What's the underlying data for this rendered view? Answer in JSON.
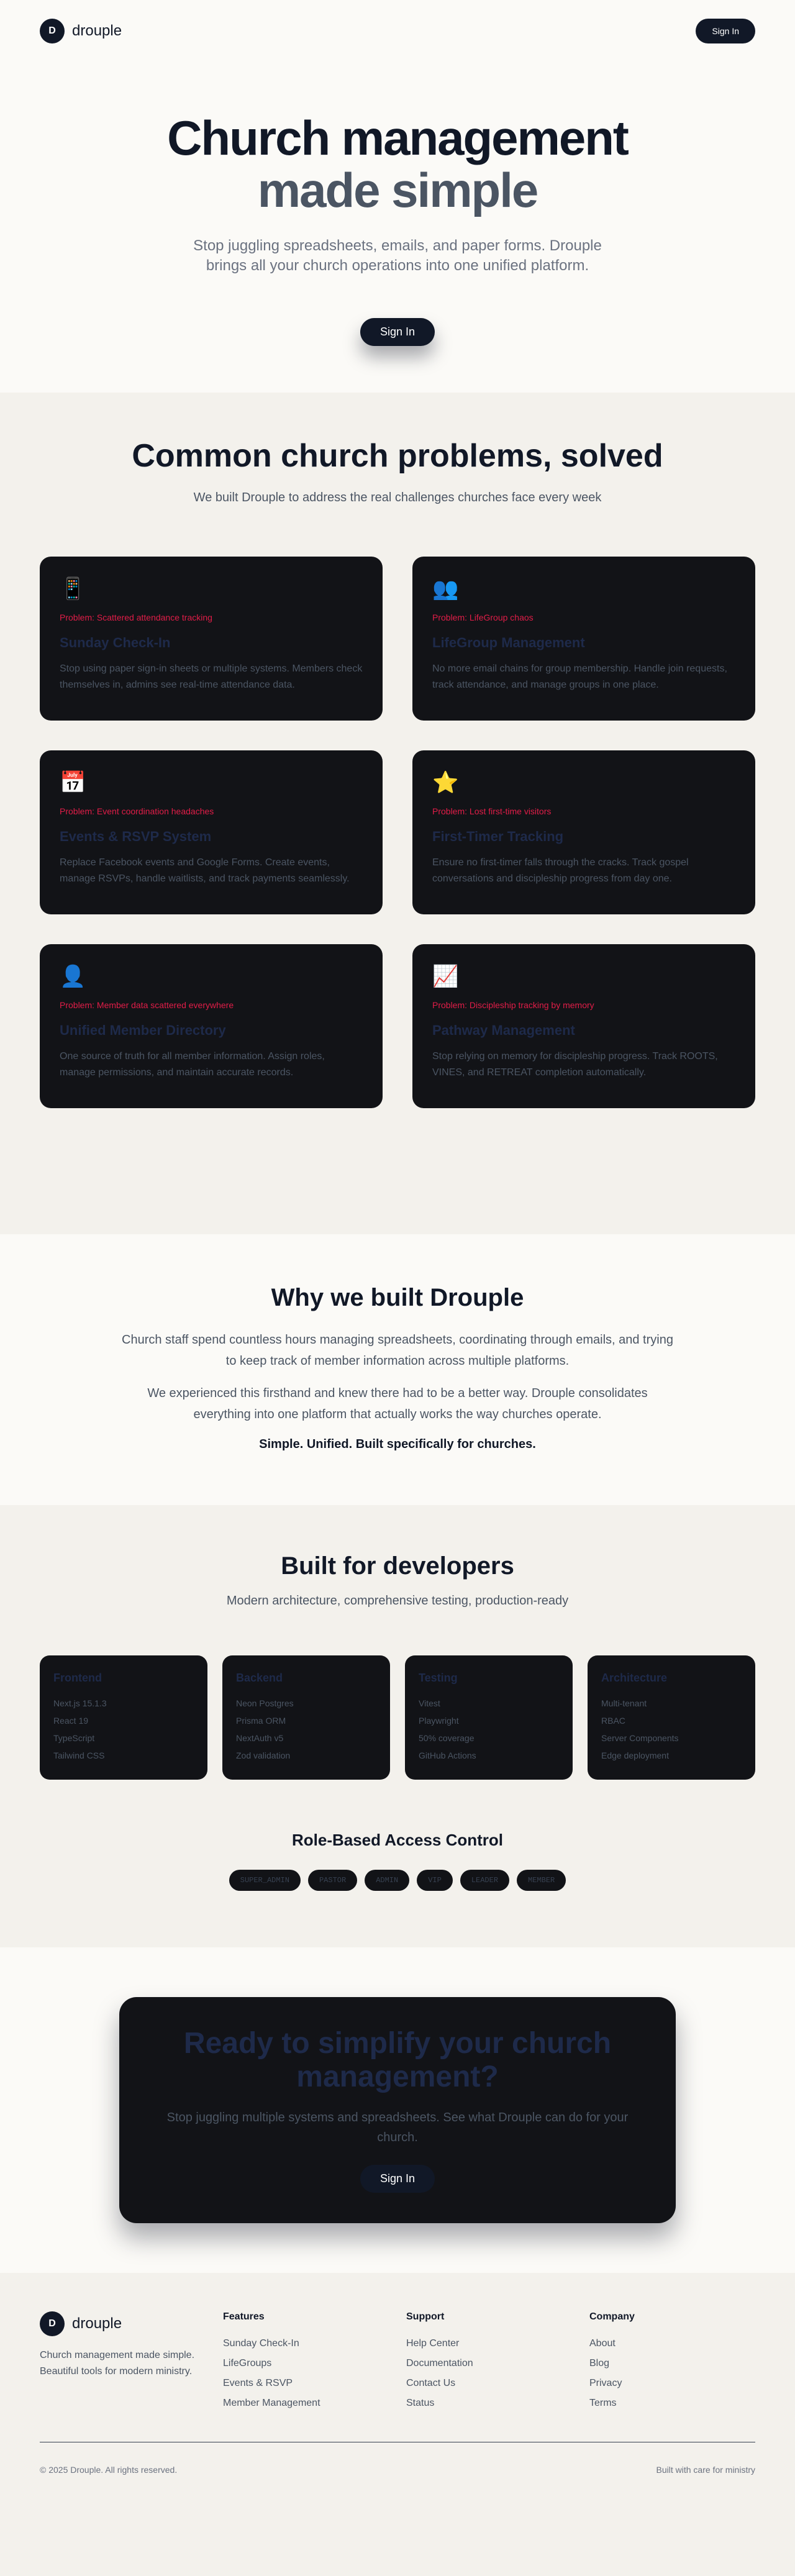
{
  "nav": {
    "logo_letter": "D",
    "brand": "drouple",
    "signin": "Sign In"
  },
  "hero": {
    "title_line1": "Church management",
    "title_line2": "made simple",
    "subtitle": "Stop juggling spreadsheets, emails, and paper forms. Drouple brings all your church operations into one unified platform.",
    "signin": "Sign In"
  },
  "problems": {
    "title": "Common church problems, solved",
    "subtitle": "We built Drouple to address the real challenges churches face every week",
    "cards": [
      {
        "icon": "📱",
        "icon_name": "mobile-phone-icon",
        "problem": "Problem: Scattered attendance tracking",
        "title": "Sunday Check-In",
        "desc": "Stop using paper sign-in sheets or multiple systems. Members check themselves in, admins see real-time attendance data."
      },
      {
        "icon": "👥",
        "icon_name": "people-icon",
        "problem": "Problem: LifeGroup chaos",
        "title": "LifeGroup Management",
        "desc": "No more email chains for group membership. Handle join requests, track attendance, and manage groups in one place."
      },
      {
        "icon": "📅",
        "icon_name": "calendar-icon",
        "problem": "Problem: Event coordination headaches",
        "title": "Events & RSVP System",
        "desc": "Replace Facebook events and Google Forms. Create events, manage RSVPs, handle waitlists, and track payments seamlessly."
      },
      {
        "icon": "⭐",
        "icon_name": "star-icon",
        "problem": "Problem: Lost first-time visitors",
        "title": "First-Timer Tracking",
        "desc": "Ensure no first-timer falls through the cracks. Track gospel conversations and discipleship progress from day one."
      },
      {
        "icon": "👤",
        "icon_name": "person-icon",
        "problem": "Problem: Member data scattered everywhere",
        "title": "Unified Member Directory",
        "desc": "One source of truth for all member information. Assign roles, manage permissions, and maintain accurate records."
      },
      {
        "icon": "📈",
        "icon_name": "chart-increasing-icon",
        "problem": "Problem: Discipleship tracking by memory",
        "title": "Pathway Management",
        "desc": "Stop relying on memory for discipleship progress. Track ROOTS, VINES, and RETREAT completion automatically."
      }
    ]
  },
  "why": {
    "title": "Why we built Drouple",
    "p1": "Church staff spend countless hours managing spreadsheets, coordinating through emails, and trying to keep track of member information across multiple platforms.",
    "p2": "We experienced this firsthand and knew there had to be a better way. Drouple consolidates everything into one platform that actually works the way churches operate.",
    "tagline": "Simple. Unified. Built specifically for churches."
  },
  "devs": {
    "title": "Built for developers",
    "subtitle": "Modern architecture, comprehensive testing, production-ready",
    "cards": [
      {
        "title": "Frontend",
        "items": [
          "Next.js 15.1.3",
          "React 19",
          "TypeScript",
          "Tailwind CSS"
        ]
      },
      {
        "title": "Backend",
        "items": [
          "Neon Postgres",
          "Prisma ORM",
          "NextAuth v5",
          "Zod validation"
        ]
      },
      {
        "title": "Testing",
        "items": [
          "Vitest",
          "Playwright",
          "50% coverage",
          "GitHub Actions"
        ]
      },
      {
        "title": "Architecture",
        "items": [
          "Multi-tenant",
          "RBAC",
          "Server Components",
          "Edge deployment"
        ]
      }
    ],
    "rbac_title": "Role-Based Access Control",
    "roles": [
      "SUPER_ADMIN",
      "PASTOR",
      "ADMIN",
      "VIP",
      "LEADER",
      "MEMBER"
    ]
  },
  "cta": {
    "title": "Ready to simplify your church management?",
    "text": "Stop juggling multiple systems and spreadsheets. See what Drouple can do for your church.",
    "signin": "Sign In"
  },
  "footer": {
    "logo_letter": "D",
    "brand": "drouple",
    "desc": "Church management made simple. Beautiful tools for modern ministry.",
    "columns": [
      {
        "title": "Features",
        "links": [
          "Sunday Check-In",
          "LifeGroups",
          "Events & RSVP",
          "Member Management"
        ]
      },
      {
        "title": "Support",
        "links": [
          "Help Center",
          "Documentation",
          "Contact Us",
          "Status"
        ]
      },
      {
        "title": "Company",
        "links": [
          "About",
          "Blog",
          "Privacy",
          "Terms"
        ]
      }
    ],
    "copyright": "© 2025 Drouple. All rights reserved.",
    "tagline": "Built with care for ministry"
  }
}
